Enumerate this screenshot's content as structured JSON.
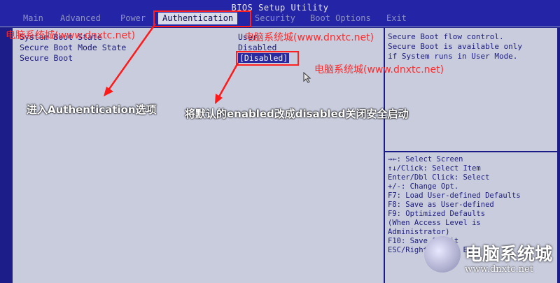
{
  "window": {
    "title": "BIOS Setup Utility"
  },
  "menu": {
    "items": [
      "Main",
      "Advanced",
      "Power",
      "Authentication",
      "Security",
      "Boot Options",
      "Exit"
    ],
    "active": "Authentication"
  },
  "settings": [
    {
      "label": "System Boot State",
      "value": "User"
    },
    {
      "label": "Secure Boot Mode State",
      "value": "Disabled"
    },
    {
      "label": "Secure Boot",
      "value": "[Disabled]"
    }
  ],
  "help": {
    "lines": [
      "Secure Boot flow control.",
      "Secure Boot is available only",
      "if System runs in User Mode."
    ]
  },
  "keys": [
    "→←: Select Screen",
    "↑↓/Click: Select Item",
    "Enter/Dbl Click: Select",
    "+/-: Change Opt.",
    "F7: Load User-defined Defaults",
    "F8: Save as User-defined",
    "F9: Optimized Defaults",
    "(When Access Level is",
    "Administrator)",
    "F10: Save & Exit",
    "ESC/Right Click: Exit"
  ],
  "watermarks": [
    "电脑系统城(www.dnxtc.net)",
    "电脑系统城(www.dnxtc.net)",
    "电脑系统城(www.dnxtc.net)"
  ],
  "annotations": {
    "left": "进入Authentication选项",
    "right": "将默认的enabled改成disabled关闭安全启动"
  },
  "logo": {
    "name": "电脑系统城",
    "url": "www.dnxtc.net"
  },
  "colors": {
    "highlight": "#ff2020",
    "bios_blue": "#1d1d8a",
    "panel": "#c9ccdd"
  }
}
